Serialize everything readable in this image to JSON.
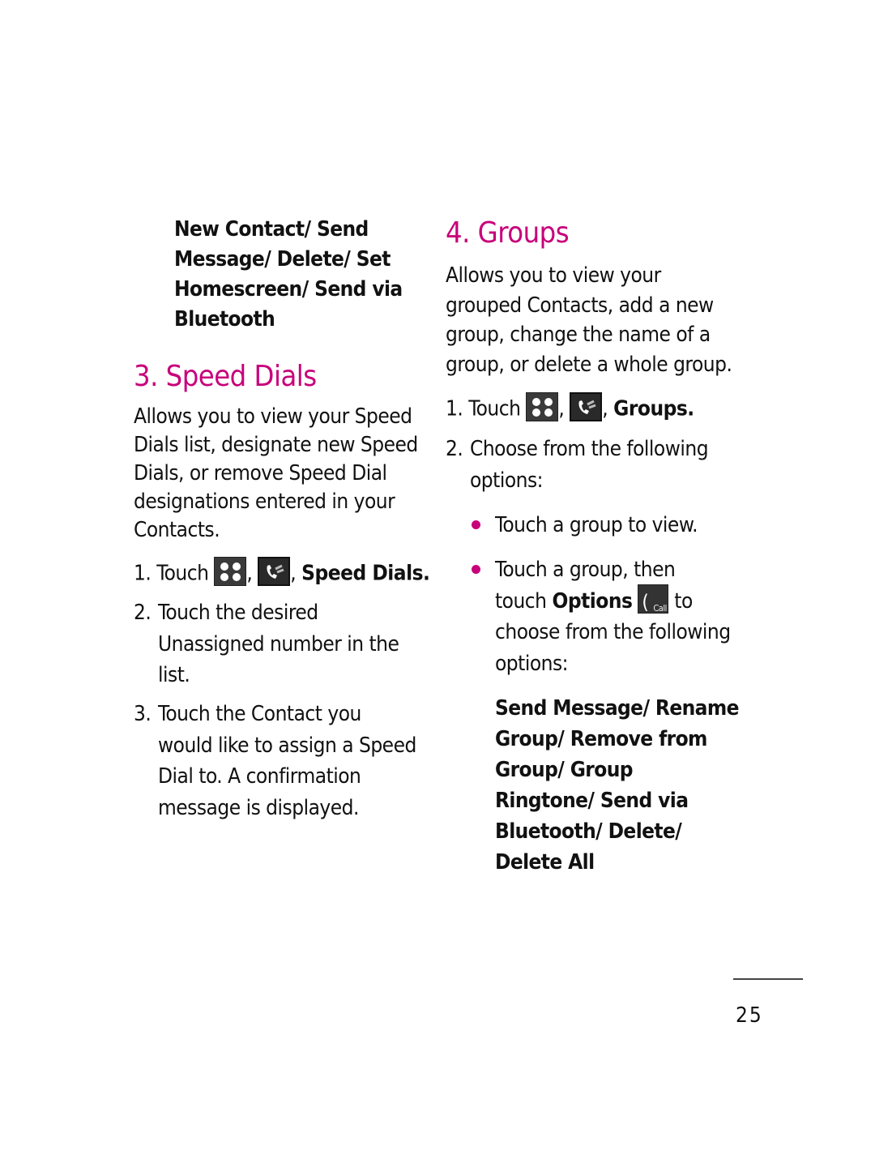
{
  "left_column": {
    "options_list": [
      "New Contact/ Send",
      "Message/ Delete/ Set",
      "Homescreen/ Send via",
      "Bluetooth"
    ],
    "speed_dials": {
      "heading": "3. Speed Dials",
      "description": [
        "Allows you to view your Speed",
        "Dials list, designate new Speed",
        "Dials, or remove Speed Dial",
        "designations entered in your",
        "Contacts."
      ],
      "step1": {
        "number": "1.",
        "prefix": "Touch",
        "comma": ",",
        "suffix_comma": ",",
        "target": "Speed Dials."
      },
      "step2": {
        "number": "2.",
        "lines": [
          "Touch the desired",
          "Unassigned number in the",
          "list."
        ]
      },
      "step3": {
        "number": "3.",
        "lines": [
          "Touch the Contact you",
          "would like to assign a Speed",
          "Dial to. A confirmation",
          "message is displayed."
        ]
      }
    }
  },
  "right_column": {
    "groups": {
      "heading": "4. Groups",
      "description": [
        "Allows you to view your",
        "grouped Contacts, add a new",
        "group, change the name of a",
        "group, or delete a whole group."
      ],
      "step1": {
        "number": "1.",
        "prefix": "Touch",
        "comma": ",",
        "suffix_comma": ",",
        "target": "Groups."
      },
      "step2": {
        "number": "2.",
        "lines": [
          "Choose from the following",
          "options:"
        ]
      },
      "bullet1": "Touch a group to view.",
      "bullet2": {
        "line1": "Touch a group, then",
        "line2_prefix": "touch",
        "line2_bold": "Options",
        "line2_suffix": "to",
        "line3": "choose from the following",
        "line4": "options:"
      },
      "options_list": [
        "Send Message/ Rename",
        "Group/ Remove from",
        "Group/ Group",
        "Ringtone/ Send via",
        "Bluetooth/ Delete/",
        "Delete All"
      ],
      "call_icon_label": "Call"
    }
  },
  "footer": {
    "page_number": "25"
  },
  "colors": {
    "accent": "#c8007a",
    "text": "#111111"
  }
}
